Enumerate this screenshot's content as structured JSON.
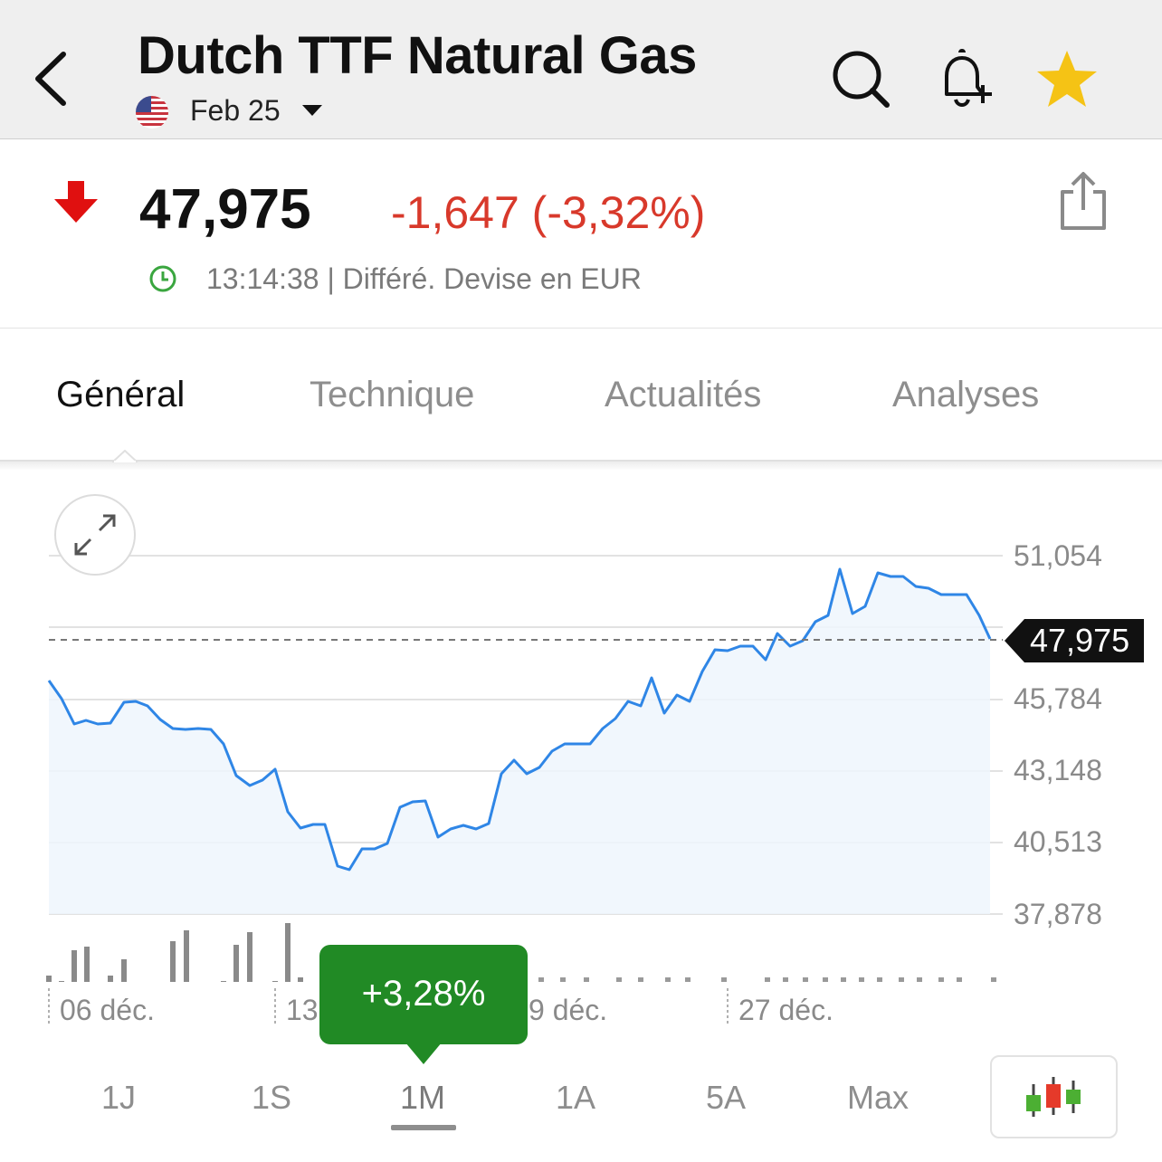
{
  "header": {
    "title": "Dutch TTF Natural Gas",
    "contract": "Feb 25"
  },
  "quote": {
    "price": "47,975",
    "change": "-1,647 (-3,32%)",
    "status": "13:14:38 | Différé. Devise en EUR",
    "direction": "down",
    "change_color": "#d8392b"
  },
  "tabs": [
    "Général",
    "Technique",
    "Actualités",
    "Analyses"
  ],
  "chart": {
    "y_ticks": [
      "51,054",
      "45,784",
      "43,148",
      "40,513",
      "37,878"
    ],
    "current_price_label": "47,975",
    "x_ticks": [
      "06 déc.",
      "13",
      "9 déc.",
      "27 déc."
    ],
    "tooltip": "+3,28%",
    "line_color": "#2f86e6",
    "tooltip_color": "#218a25"
  },
  "periods": [
    "1J",
    "1S",
    "1M",
    "1A",
    "5A",
    "Max"
  ],
  "selected_period": "1M",
  "icons": {
    "back": "chevron-left-icon",
    "search": "search-icon",
    "alert": "bell-plus-icon",
    "favorite": "star-icon",
    "share": "share-icon",
    "clock": "clock-icon",
    "expand": "expand-icon",
    "chart_type": "candlestick-icon"
  }
}
